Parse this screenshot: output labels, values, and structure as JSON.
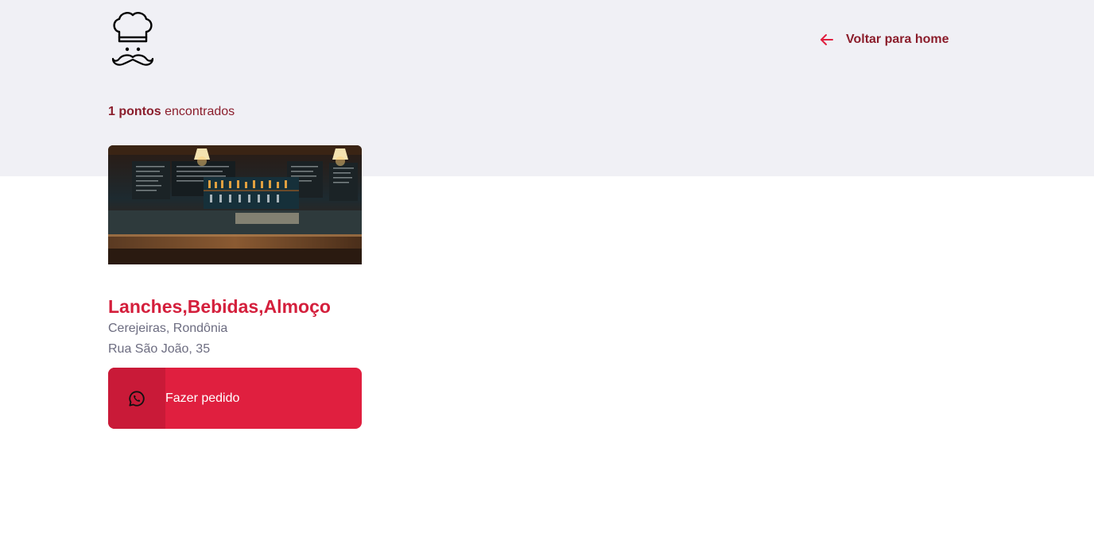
{
  "header": {
    "logo_icon": "chef-hat-mustache-icon",
    "back_label": "Voltar para home",
    "back_icon": "arrow-left-icon"
  },
  "results": {
    "count_bold": "1 pontos",
    "count_rest": " encontrados"
  },
  "cards": [
    {
      "title": "Lanches,Bebidas,Almoço",
      "city_state": "Cerejeiras, Rondônia",
      "address": "Rua São João, 35",
      "button_label": "Fazer pedido",
      "button_icon": "whatsapp-icon"
    }
  ],
  "colors": {
    "accent": "#e01f3f",
    "accent_dark": "#c91a38",
    "title": "#d41f3c",
    "link": "#8b1e2c",
    "band": "#f0f0f5",
    "muted_text": "#6c6c80"
  }
}
